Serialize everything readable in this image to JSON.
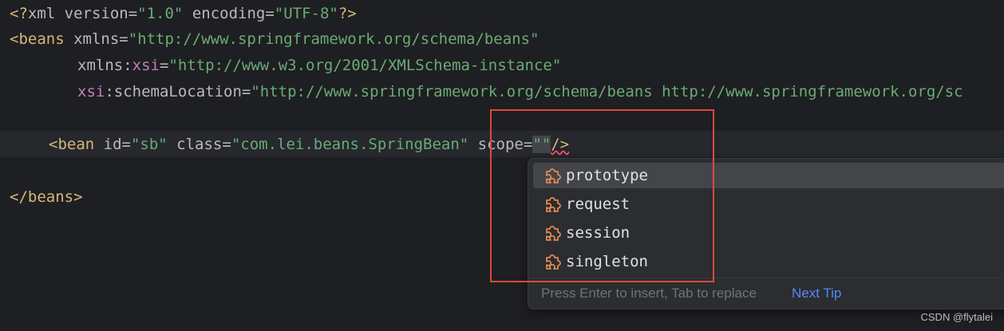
{
  "code": {
    "line1": {
      "open": "<?",
      "decl": "xml version=",
      "version": "\"1.0\"",
      "enc_attr": " encoding=",
      "enc": "\"UTF-8\"",
      "close": "?>"
    },
    "line2": {
      "tag": "<beans ",
      "attr": "xmlns=",
      "value": "\"http://www.springframework.org/schema/beans\""
    },
    "line3": {
      "attr1": "xmlns:",
      "ns": "xsi",
      "eq": "=",
      "value": "\"http://www.w3.org/2001/XMLSchema-instance\""
    },
    "line4": {
      "ns": "xsi",
      "attr": ":schemaLocation=",
      "value": "\"http://www.springframework.org/schema/beans http://www.springframework.org/sc"
    },
    "line6": {
      "tag": "<bean ",
      "id_attr": "id=",
      "id_val": "\"sb\"",
      "class_attr": " class=",
      "class_val": "\"com.lei.beans.SpringBean\"",
      "scope_attr": " scope=",
      "scope_val": "\"\"",
      "close": "/>"
    },
    "line8": {
      "tag": "</beans>"
    }
  },
  "completion": {
    "items": [
      {
        "label": "prototype",
        "icon": "puzzle-icon"
      },
      {
        "label": "request",
        "icon": "puzzle-icon"
      },
      {
        "label": "session",
        "icon": "puzzle-icon"
      },
      {
        "label": "singleton",
        "icon": "puzzle-icon"
      }
    ],
    "footer_hint": "Press Enter to insert, Tab to replace",
    "footer_tip": "Next Tip"
  },
  "watermark": "CSDN @flytalei",
  "colors": {
    "background": "#1e1f22",
    "tag": "#d5b778",
    "string": "#6aab73",
    "namespace": "#c77dbb",
    "highlight_box": "#e2463d",
    "link": "#548af7"
  }
}
